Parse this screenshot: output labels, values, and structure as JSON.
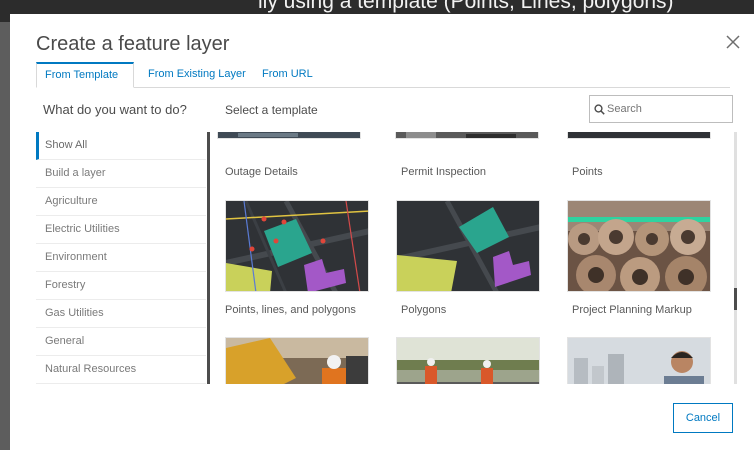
{
  "dialog": {
    "title": "Create a feature layer",
    "close_icon": "close-icon",
    "tabs": [
      {
        "label": "From Template",
        "active": true
      },
      {
        "label": "From Existing Layer",
        "active": false
      },
      {
        "label": "From URL",
        "active": false
      }
    ],
    "left_heading": "What do you want to do?",
    "template_heading": "Select a template",
    "search": {
      "placeholder": "Search",
      "value": "",
      "icon": "search-icon"
    },
    "categories": [
      {
        "label": "Show All",
        "selected": true
      },
      {
        "label": "Build a layer"
      },
      {
        "label": "Agriculture"
      },
      {
        "label": "Electric Utilities"
      },
      {
        "label": "Environment"
      },
      {
        "label": "Forestry"
      },
      {
        "label": "Gas Utilities"
      },
      {
        "label": "General"
      },
      {
        "label": "Natural Resources"
      }
    ],
    "templates": [
      {
        "label": "Outage Details"
      },
      {
        "label": "Permit Inspection"
      },
      {
        "label": "Points"
      },
      {
        "label": "Points, lines, and polygons"
      },
      {
        "label": "Polygons"
      },
      {
        "label": "Project Planning Markup"
      }
    ],
    "cancel_label": "Cancel"
  },
  "colors": {
    "accent": "#0079c1",
    "map_dark": "#2f3236",
    "polygon_teal": "#2aa58e",
    "polygon_purple": "#a358c7",
    "polygon_yellow": "#c9d15a"
  }
}
